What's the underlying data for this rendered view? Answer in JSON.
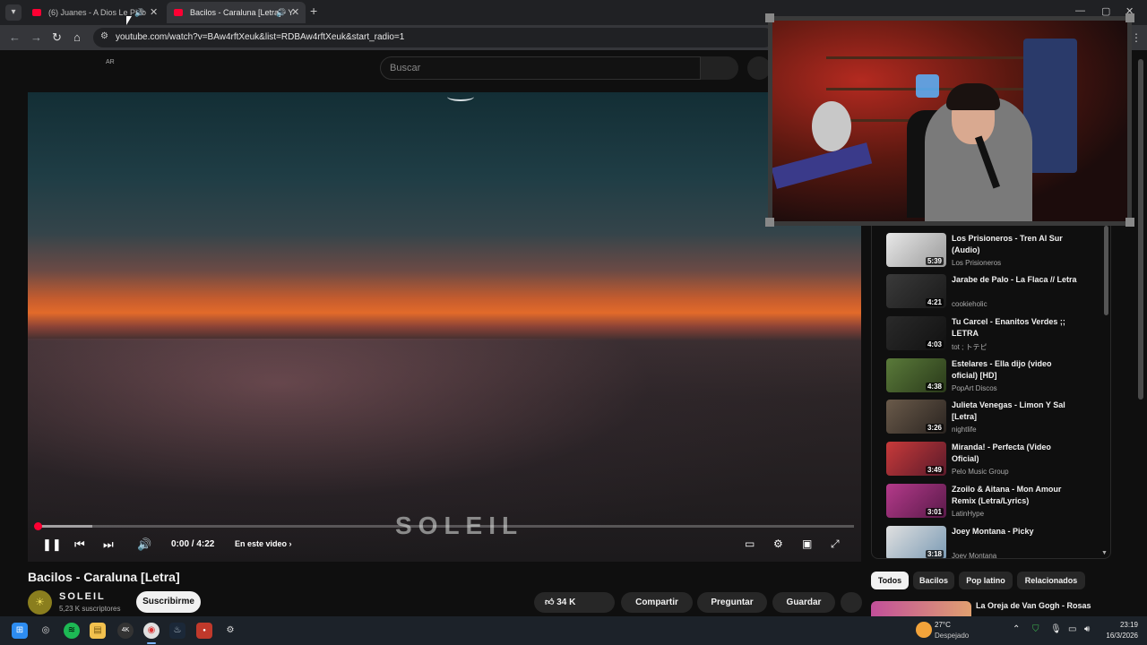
{
  "browser": {
    "tabs": [
      {
        "label": "(6) Juanes - A Dios Le Pido",
        "active": false
      },
      {
        "label": "Bacilos - Caraluna [Letra] - Y",
        "active": true
      }
    ],
    "url": "youtube.com/watch?v=BAw4rftXeuk&list=RDBAw4rftXeuk&start_radio=1"
  },
  "youtube": {
    "country_code": "AR",
    "search_placeholder": "Buscar",
    "player": {
      "watermark": "SOLEIL",
      "time": "0:00 / 4:22",
      "chapter_label": "En este video",
      "progress_loaded_fraction": 0.07
    },
    "video_title": "Bacilos - Caraluna [Letra]",
    "channel": {
      "name": "SOLEIL",
      "subscribers": "5,23 K suscriptores"
    },
    "subscribe_label": "Suscribirme",
    "actions": {
      "likes": "34 K",
      "share": "Compartir",
      "ask": "Preguntar",
      "save": "Guardar"
    },
    "recommendations": [
      {
        "title": "Los Prisioneros - Tren Al Sur (Audio)",
        "channel": "Los Prisioneros",
        "duration": "5:39"
      },
      {
        "title": "Jarabe de Palo - La Flaca // Letra",
        "channel": "cookieholic",
        "duration": "4:21"
      },
      {
        "title": "Tu Carcel - Enanitos Verdes ;; LETRA",
        "channel": "tot ; トテピ",
        "duration": "4:03"
      },
      {
        "title": "Estelares - Ella dijo (video oficial) [HD]",
        "channel": "PopArt Discos",
        "duration": "4:38"
      },
      {
        "title": "Julieta Venegas - Limon Y Sal [Letra]",
        "channel": "nightlife",
        "duration": "3:26"
      },
      {
        "title": "Miranda! - Perfecta (Video Oficial)",
        "channel": "Pelo Music Group",
        "duration": "3:49"
      },
      {
        "title": "Zzoilo & Aitana - Mon Amour Remix (Letra/Lyrics)",
        "channel": "LatinHype",
        "duration": "3:01"
      },
      {
        "title": "Joey Montana - Picky",
        "channel": "Joey Montana",
        "duration": "3:18"
      }
    ],
    "chips": [
      "Todos",
      "Bacilos",
      "Pop latino",
      "Relacionados"
    ],
    "next_title": "La Oreja de Van Gogh - Rosas"
  },
  "taskbar": {
    "weather_temp": "27°C",
    "weather_desc": "Despejado",
    "time": "23:19",
    "date": "16/3/2026"
  },
  "colors": {
    "accent": "#ff0033",
    "page_bg": "#0f0f0f",
    "taskbar_bg": "#1c2229"
  }
}
